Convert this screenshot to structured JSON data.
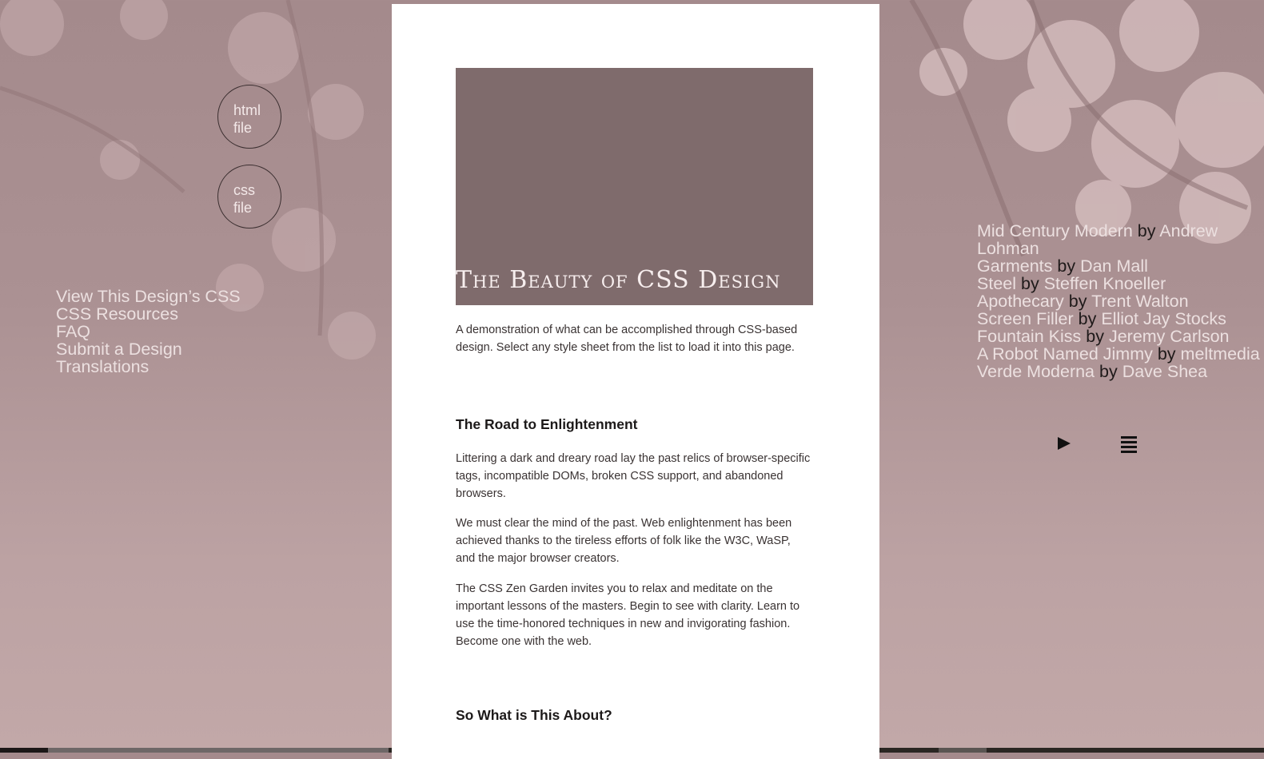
{
  "colors": {
    "page_background": "#ab9193",
    "article_background": "#ffffff",
    "hero_background": "#7f6b6c",
    "link_light": "#ece0e0",
    "text_dark": "#1f1a1a"
  },
  "file_buttons": [
    {
      "line1": "html",
      "line2": "file"
    },
    {
      "line1": "css",
      "line2": "file"
    }
  ],
  "left_nav": [
    "View This Design’s CSS",
    "CSS Resources",
    "FAQ",
    "Submit a Design",
    "Translations"
  ],
  "article": {
    "title": "The Beauty of CSS Design",
    "intro": "A demonstration of what can be accomplished through CSS-based design. Select any style sheet from the list to load it into this page.",
    "section1_heading": "The Road to Enlightenment",
    "section1_p1": "Littering a dark and dreary road lay the past relics of browser-specific tags, incompatible DOMs, broken CSS support, and abandoned browsers.",
    "section1_p2": "We must clear the mind of the past. Web enlightenment has been achieved thanks to the tireless efforts of folk like the W3C, WaSP, and the major browser creators.",
    "section1_p3": "The CSS Zen Garden invites you to relax and meditate on the important lessons of the masters. Begin to see with clarity. Learn to use the time-honored techniques in new and invigorating fashion. Become one with the web.",
    "section2_heading": "So What is This About?"
  },
  "design_list": {
    "by_word": "by",
    "items": [
      {
        "design": "Mid Century Modern",
        "author": "Andrew Lohman"
      },
      {
        "design": "Garments",
        "author": "Dan Mall"
      },
      {
        "design": "Steel",
        "author": "Steffen Knoeller"
      },
      {
        "design": "Apothecary",
        "author": "Trent Walton"
      },
      {
        "design": "Screen Filler",
        "author": "Elliot Jay Stocks"
      },
      {
        "design": "Fountain Kiss",
        "author": "Jeremy Carlson"
      },
      {
        "design": "A Robot Named Jimmy",
        "author": "meltmedia"
      },
      {
        "design": "Verde Moderna",
        "author": "Dave Shea"
      }
    ]
  },
  "controls": {
    "next_icon": "play-icon",
    "all_designs_icon": "list-icon"
  }
}
